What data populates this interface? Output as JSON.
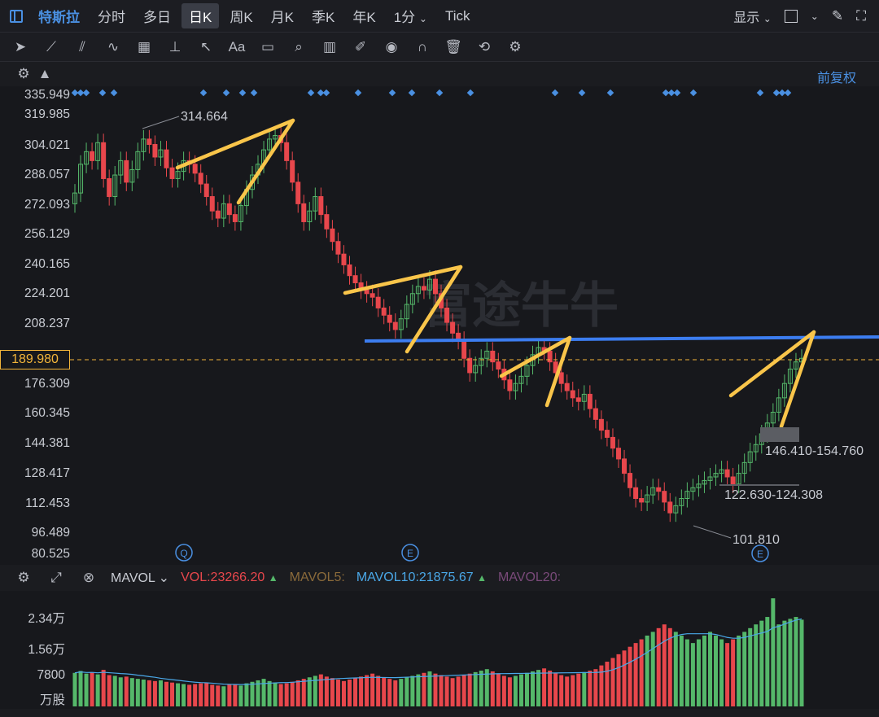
{
  "topbar": {
    "title": "特斯拉",
    "tabs": [
      "分时",
      "多日",
      "日K",
      "周K",
      "月K",
      "季K",
      "年K",
      "1分",
      "Tick"
    ],
    "active_tab": "日K",
    "display_label": "显示"
  },
  "subbar": {
    "fuquan": "前复权"
  },
  "price_axis": [
    "335.949",
    "319.985",
    "304.021",
    "288.057",
    "272.093",
    "256.129",
    "240.165",
    "224.201",
    "208.237",
    "176.309",
    "160.345",
    "144.381",
    "128.417",
    "112.453",
    "96.489",
    "80.525"
  ],
  "current_price": "189.980",
  "annotations": {
    "high": "314.664",
    "low": "101.810",
    "gap1": "146.410-154.760",
    "gap2": "122.630-124.308",
    "q_marker": "Q",
    "e_marker1": "E",
    "e_marker2": "E"
  },
  "watermark": "富途牛牛",
  "volume_bar": {
    "name": "MAVOL",
    "vol": "VOL:23266.20",
    "mavol5": "MAVOL5:",
    "mavol10": "MAVOL10:21875.67",
    "mavol20": "MAVOL20:"
  },
  "volume_axis": [
    "2.34万",
    "1.56万",
    "7800",
    "万股"
  ],
  "colors": {
    "up": "#55b86a",
    "down": "#e8474c",
    "accent": "#4a90e2",
    "trend": "#f9c54a",
    "price_line": "#f3b53a"
  },
  "chart_data": {
    "type": "candlestick",
    "y_range": [
      80.525,
      335.949
    ],
    "closes": [
      282,
      298,
      305,
      300,
      310,
      290,
      280,
      292,
      300,
      288,
      295,
      305,
      312,
      309,
      302,
      306,
      296,
      290,
      294,
      300,
      298,
      293,
      287,
      280,
      272,
      268,
      276,
      270,
      266,
      275,
      284,
      292,
      298,
      306,
      312,
      314,
      310,
      300,
      288,
      276,
      266,
      272,
      280,
      270,
      262,
      255,
      248,
      242,
      236,
      232,
      228,
      226,
      224,
      218,
      214,
      210,
      206,
      212,
      220,
      226,
      230,
      228,
      234,
      226,
      218,
      210,
      204,
      200,
      190,
      182,
      186,
      190,
      194,
      188,
      184,
      178,
      172,
      176,
      180,
      186,
      192,
      196,
      194,
      188,
      182,
      176,
      172,
      168,
      166,
      170,
      162,
      156,
      150,
      146,
      140,
      134,
      126,
      118,
      112,
      110,
      114,
      118,
      116,
      110,
      104,
      108,
      112,
      116,
      118,
      120,
      122,
      124,
      126,
      128,
      124,
      120,
      126,
      132,
      138,
      142,
      148,
      154,
      160,
      168,
      176,
      184,
      188,
      190
    ],
    "volumes": [
      9000,
      9500,
      8800,
      9200,
      8600,
      9800,
      8400,
      8200,
      7800,
      8000,
      7600,
      7400,
      7200,
      7000,
      6800,
      7000,
      6600,
      6400,
      6200,
      6000,
      5800,
      6000,
      6200,
      6400,
      5800,
      5600,
      5400,
      6000,
      5800,
      5600,
      6200,
      6600,
      7000,
      7400,
      6800,
      6400,
      6000,
      6200,
      6600,
      7000,
      7400,
      7800,
      8200,
      8600,
      8000,
      7600,
      7200,
      6800,
      7200,
      7600,
      8000,
      8400,
      8800,
      8200,
      7800,
      7400,
      7000,
      7400,
      7800,
      8200,
      8600,
      9000,
      9400,
      8800,
      8400,
      8000,
      7600,
      8000,
      8400,
      8800,
      9200,
      9600,
      10000,
      9400,
      8800,
      8200,
      7800,
      8200,
      8600,
      9000,
      9400,
      9800,
      10200,
      9600,
      9000,
      8400,
      8000,
      8400,
      8800,
      9200,
      9600,
      10000,
      11000,
      12000,
      13000,
      14000,
      15000,
      16000,
      17000,
      18000,
      19000,
      20000,
      21000,
      22000,
      21000,
      20000,
      19000,
      18000,
      17000,
      18000,
      19000,
      20000,
      19000,
      18000,
      17000,
      18000,
      19000,
      20000,
      21000,
      22000,
      23000,
      24000,
      29000,
      22000,
      23000,
      23500,
      24000,
      23266
    ]
  }
}
